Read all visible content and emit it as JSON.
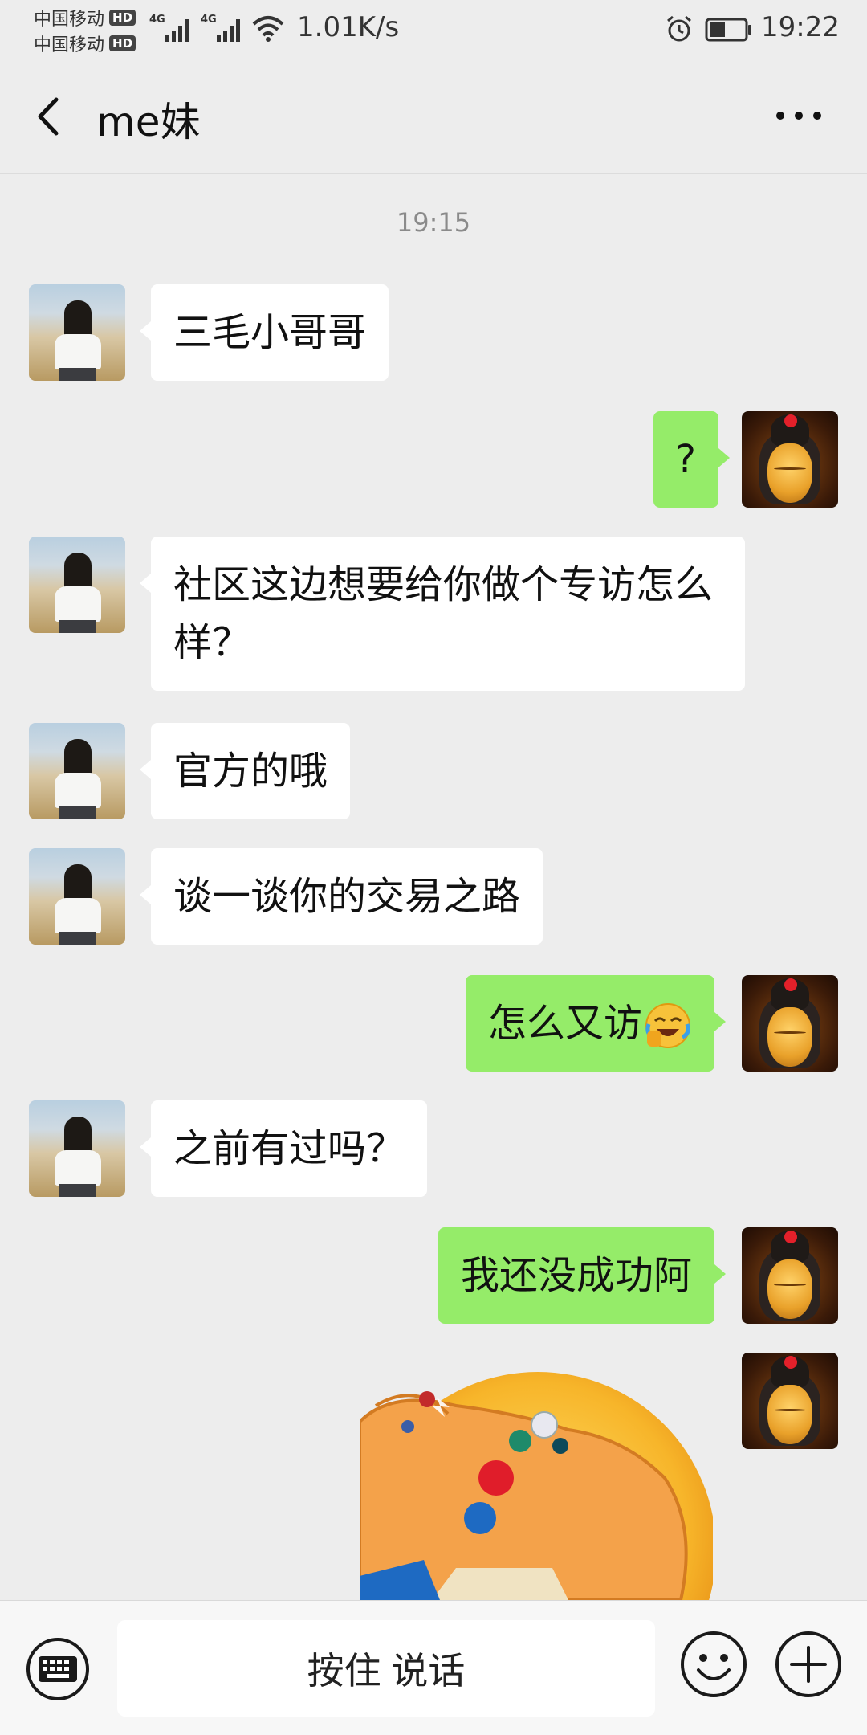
{
  "status_bar": {
    "carrier_1": "中国移动",
    "carrier_2": "中国移动",
    "hd_badge": "HD",
    "net_type": "4G",
    "net_speed": "1.01K/s",
    "time": "19:22",
    "battery_level": 0.45
  },
  "header": {
    "title": "me妹"
  },
  "chat": {
    "timestamp": "19:15",
    "messages": [
      {
        "side": "left",
        "text": "三毛小哥哥"
      },
      {
        "side": "right",
        "text": "?"
      },
      {
        "side": "left",
        "text": "社区这边想要给你做个专访怎么样？"
      },
      {
        "side": "left",
        "text": "官方的哦"
      },
      {
        "side": "left",
        "text": "谈一谈你的交易之路"
      },
      {
        "side": "right",
        "text": "怎么又访",
        "emoji": "laughing-crying-emoji"
      },
      {
        "side": "left",
        "text": "之前有过吗？"
      },
      {
        "side": "right",
        "text": "我还没成功阿"
      },
      {
        "side": "right",
        "sticker": "hand-with-jeweled-rings-sticker"
      }
    ]
  },
  "input_bar": {
    "voice_button_label": "按住 说话",
    "left_icon": "keyboard-icon",
    "emoji_icon": "smile-icon",
    "more_icon": "plus-icon"
  },
  "colors": {
    "background": "#ededed",
    "bubble_self": "#95ec69",
    "bubble_other": "#ffffff"
  }
}
